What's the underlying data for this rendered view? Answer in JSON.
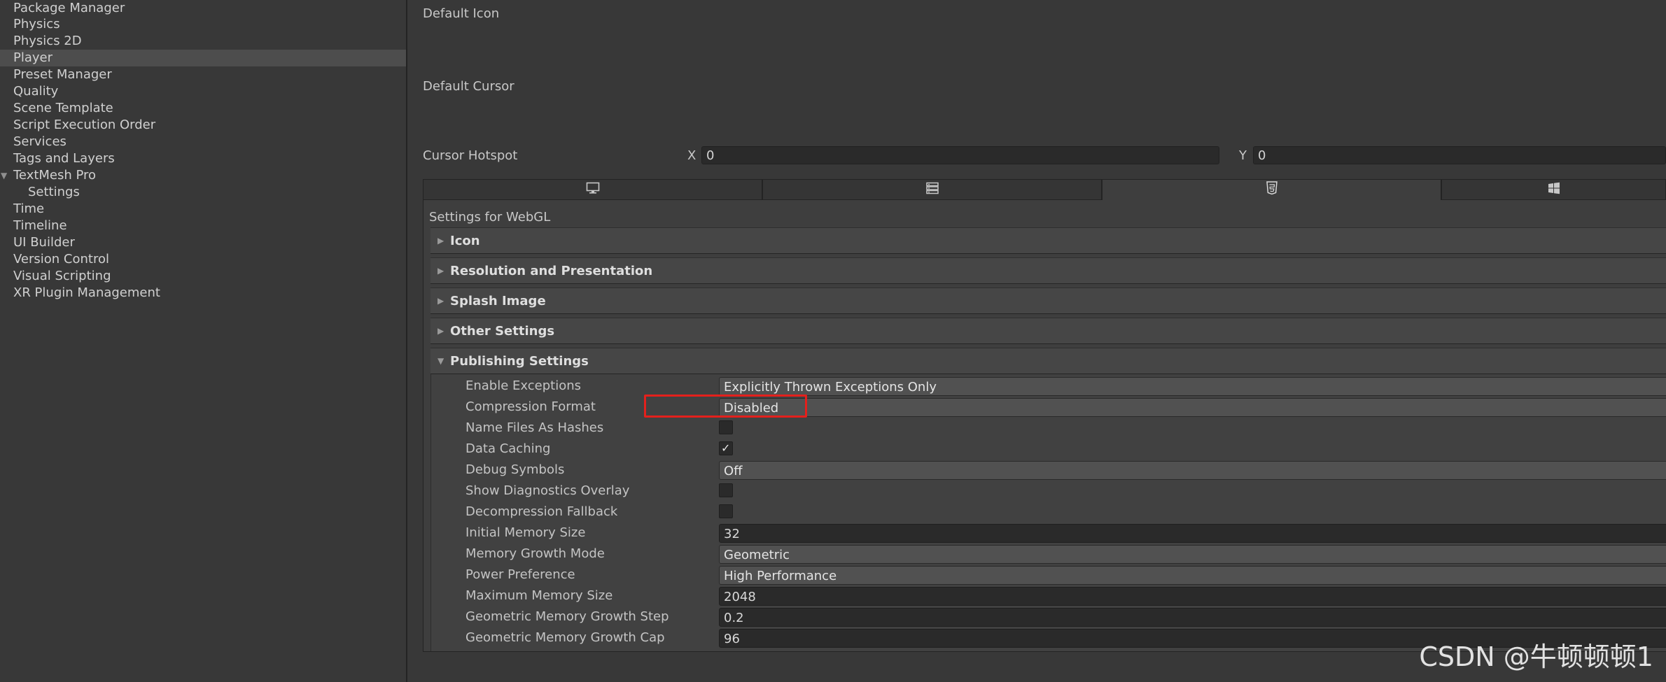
{
  "sidebar": {
    "items": [
      {
        "label": "Package Manager"
      },
      {
        "label": "Physics"
      },
      {
        "label": "Physics 2D"
      },
      {
        "label": "Player",
        "selected": true
      },
      {
        "label": "Preset Manager"
      },
      {
        "label": "Quality"
      },
      {
        "label": "Scene Template"
      },
      {
        "label": "Script Execution Order"
      },
      {
        "label": "Services"
      },
      {
        "label": "Tags and Layers"
      },
      {
        "label": "TextMesh Pro",
        "expanded": true
      },
      {
        "label": "Settings",
        "child": true
      },
      {
        "label": "Time"
      },
      {
        "label": "Timeline"
      },
      {
        "label": "UI Builder"
      },
      {
        "label": "Version Control"
      },
      {
        "label": "Visual Scripting"
      },
      {
        "label": "XR Plugin Management"
      }
    ]
  },
  "top": {
    "default_icon_label": "Default Icon",
    "default_cursor_label": "Default Cursor",
    "cursor_hotspot_label": "Cursor Hotspot",
    "x_label": "X",
    "x_value": "0",
    "y_label": "Y",
    "y_value": "0"
  },
  "platform_tabs": [
    {
      "icon": "monitor-icon"
    },
    {
      "icon": "server-icon"
    },
    {
      "icon": "html5-icon",
      "active": true
    },
    {
      "icon": "windows-icon"
    }
  ],
  "settings_for": "Settings for WebGL",
  "foldouts": [
    {
      "label": "Icon",
      "expanded": false
    },
    {
      "label": "Resolution and Presentation",
      "expanded": false
    },
    {
      "label": "Splash Image",
      "expanded": false
    },
    {
      "label": "Other Settings",
      "expanded": false
    },
    {
      "label": "Publishing Settings",
      "expanded": true
    }
  ],
  "publishing": {
    "enable_exceptions": {
      "label": "Enable Exceptions",
      "value": "Explicitly Thrown Exceptions Only"
    },
    "compression_format": {
      "label": "Compression Format",
      "value": "Disabled"
    },
    "name_files_as_hashes": {
      "label": "Name Files As Hashes",
      "checked": false
    },
    "data_caching": {
      "label": "Data Caching",
      "checked": true
    },
    "debug_symbols": {
      "label": "Debug Symbols",
      "value": "Off"
    },
    "show_diagnostics_overlay": {
      "label": "Show Diagnostics Overlay",
      "checked": false
    },
    "decompression_fallback": {
      "label": "Decompression Fallback",
      "checked": false
    },
    "initial_memory_size": {
      "label": "Initial Memory Size",
      "value": "32"
    },
    "memory_growth_mode": {
      "label": "Memory Growth Mode",
      "value": "Geometric"
    },
    "power_preference": {
      "label": "Power Preference",
      "value": "High Performance"
    },
    "maximum_memory_size": {
      "label": "Maximum Memory Size",
      "value": "2048"
    },
    "geometric_memory_growth_step": {
      "label": "Geometric Memory Growth Step",
      "value": "0.2"
    },
    "geometric_memory_growth_cap": {
      "label": "Geometric Memory Growth Cap",
      "value": "96"
    }
  },
  "checkmark": "✓",
  "highlight_color": "#e4201c",
  "watermark": "CSDN @牛顿顿顿1"
}
